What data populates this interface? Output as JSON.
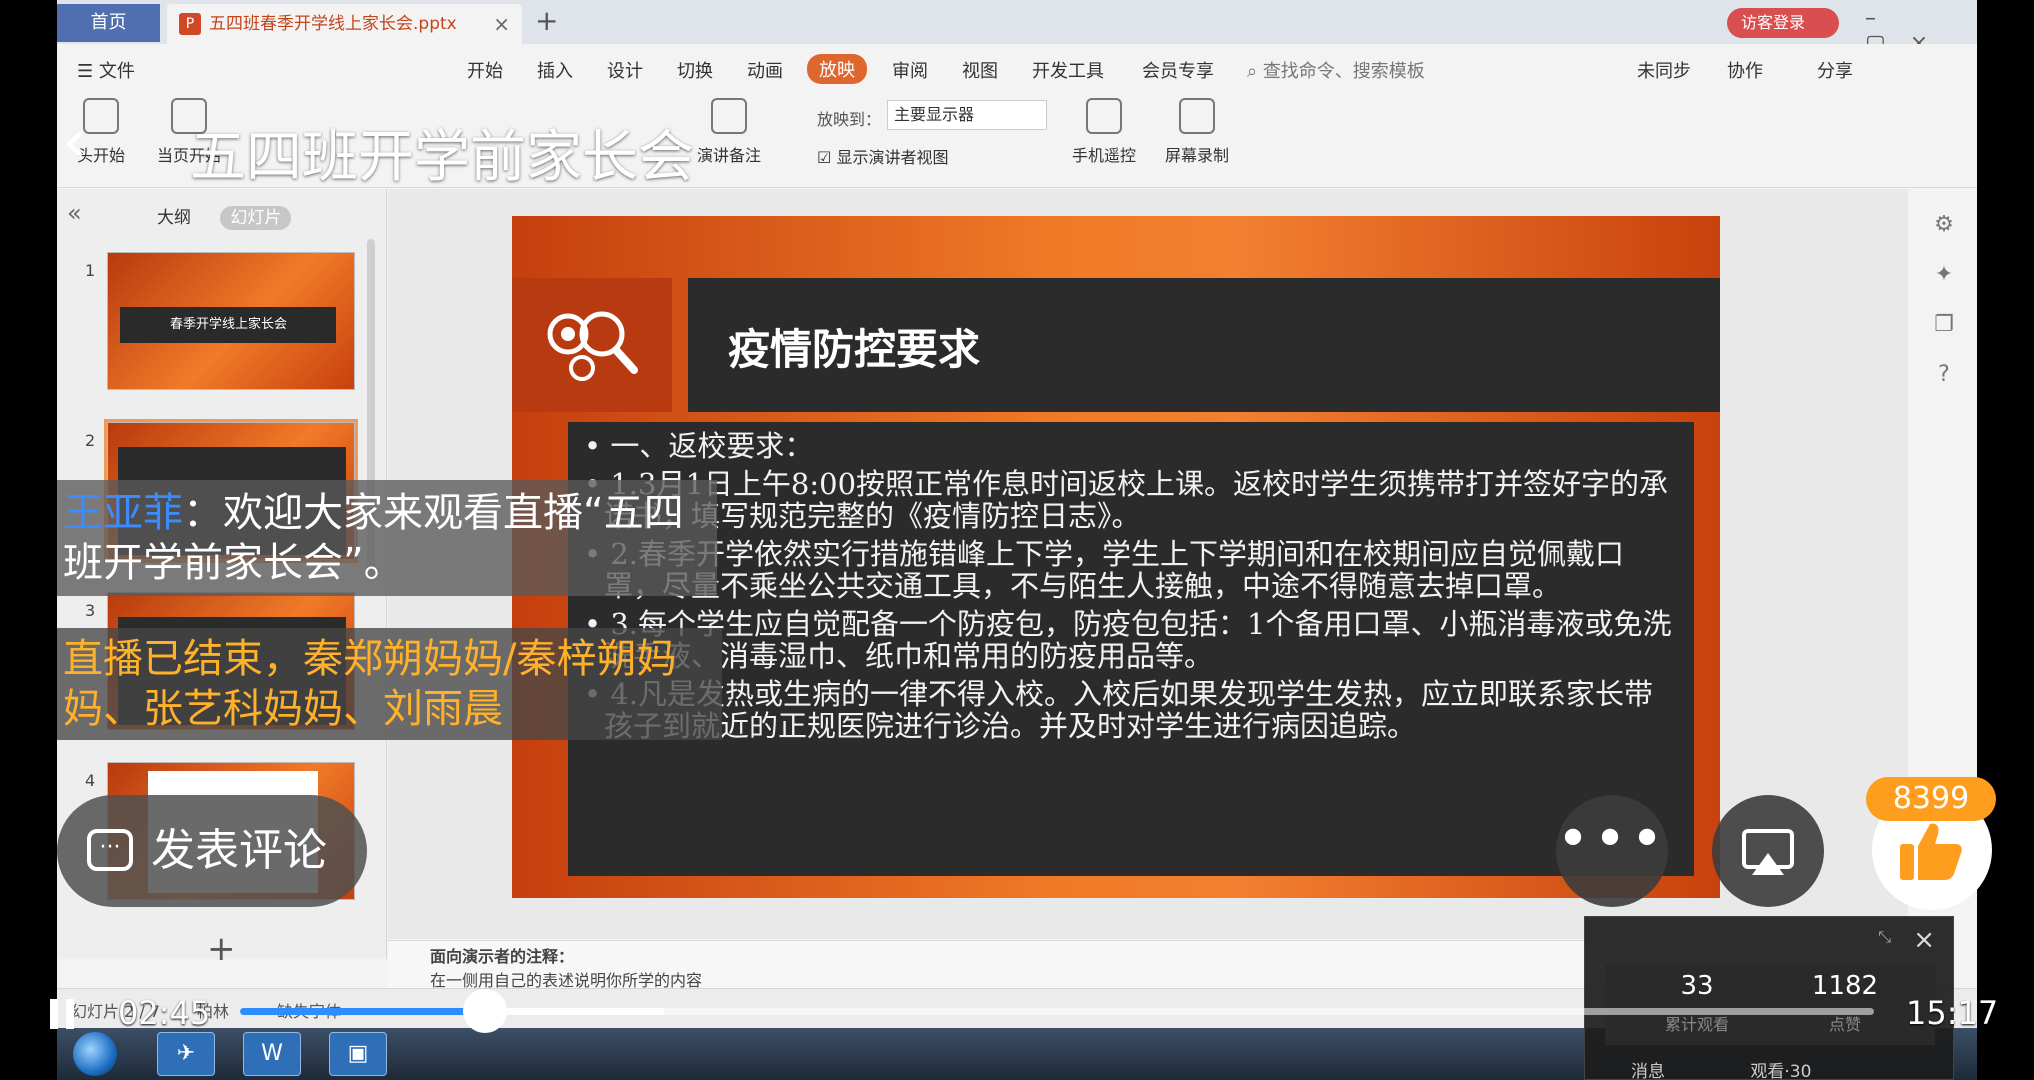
{
  "desktop": {
    "tabs": {
      "home": "首页",
      "doc": "五四班春季开学线上家长会.pptx"
    },
    "visitor_login": "访客登录",
    "menu": {
      "file": "文件",
      "items": [
        "开始",
        "插入",
        "设计",
        "切换",
        "动画",
        "放映",
        "审阅",
        "视图",
        "开发工具",
        "会员专享"
      ],
      "active": "放映",
      "search": "查找命令、搜索模板",
      "sync": "未同步",
      "collab": "协作",
      "share": "分享"
    },
    "toolbar": {
      "tools": [
        "头开始",
        "当页开始",
        "演讲备注",
        "手机遥控",
        "屏幕录制"
      ],
      "cast_label": "放映到：",
      "cast_value": "主要显示器",
      "presenter_view": "显示演讲者视图"
    },
    "sidebar": {
      "tab_outline": "大纲",
      "tab_slides": "幻灯片",
      "slides": [
        {
          "num": "1",
          "title": "春季开学线上家长会"
        },
        {
          "num": "2",
          "title": "疫情防控要求"
        },
        {
          "num": "3",
          "title": ""
        },
        {
          "num": "4",
          "title": ""
        }
      ]
    },
    "slide": {
      "title": "疫情防控要求",
      "bullets": [
        "一、返校要求：",
        "1.3月1日上午8:00按照正常作息时间返校上课。返校时学生须携带打并签好字的承诺书，填写规范完整的《疫情防控日志》。",
        "2.春季开学依然实行措施错峰上下学，学生上下学期间和在校期间应自觉佩戴口罩，尽量不乘坐公共交通工具，不与陌生人接触，中途不得随意去掉口罩。",
        "3.每个学生应自觉配备一个防疫包，防疫包包括：1个备用口罩、小瓶消毒液或免洗洗手液、消毒湿巾、纸巾和常用的防疫用品等。",
        "4.凡是发热或生病的一律不得入校。入校后如果发现学生发热，应立即联系家长带孩子到就近的正规医院进行诊治。并及时对学生进行病因追踪。"
      ]
    },
    "notes_label": "面向演示者的注释：",
    "notes_text": "在一侧用自己的表述说明你所学的内容",
    "status": {
      "slide_index": "幻灯片 2 / 7",
      "theme": "柏林",
      "missing_fonts": "缺失字体"
    }
  },
  "player": {
    "title": "五四班开学前家长会",
    "chat": {
      "user": "王亚菲",
      "separator": "：",
      "message": "欢迎大家来观看直播“五四班开学前家长会”。"
    },
    "notice": "直播已结束，秦郑朔妈妈/秦梓朔妈妈、张艺科妈妈、刘雨晨",
    "comment_button": "发表评论",
    "likes": "8399",
    "stats": {
      "viewers_value": "33",
      "viewers_label": "累计观看",
      "likes_value": "1182",
      "likes_label": "点赞",
      "tab_messages": "消息",
      "tab_watch": "观看·30"
    },
    "elapsed": "02:45",
    "duration": "15:17",
    "progress": 0.15,
    "buffered": 0.26
  },
  "colors": {
    "accent": "#2f8cff",
    "notice": "#ffb12a",
    "chat_user": "#3c8cff",
    "like_badge": "#ff9d1e"
  }
}
